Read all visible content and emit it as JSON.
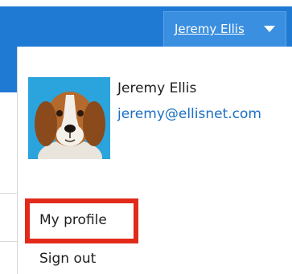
{
  "header": {
    "user_name": "Jeremy Ellis"
  },
  "profile_card": {
    "name": "Jeremy Ellis",
    "email": "jeremy@ellisnet.com",
    "avatar_alt": "beagle-dog-photo"
  },
  "menu": {
    "items": [
      {
        "label": "My profile"
      },
      {
        "label": "Sign out"
      }
    ]
  },
  "colors": {
    "header_blue": "#1f7ad4",
    "trigger_blue": "#3a8fe0",
    "link_blue": "#1a6fc4",
    "highlight_red": "#e22a1b"
  }
}
